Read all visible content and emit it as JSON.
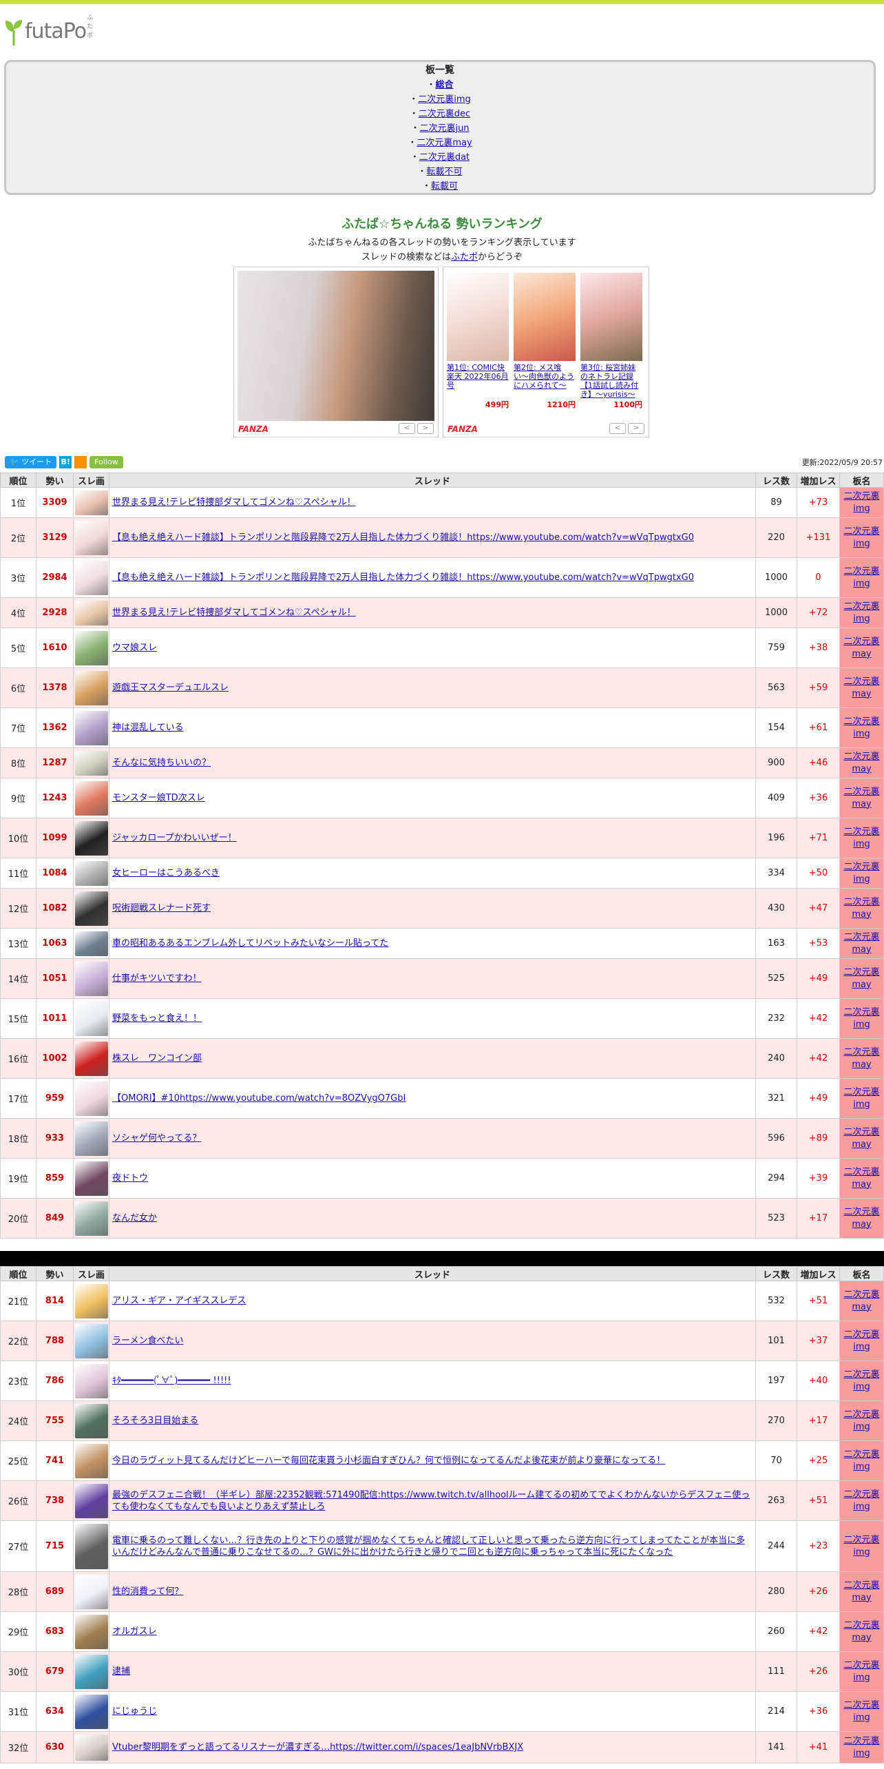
{
  "header": {
    "logo_text": "futaPo",
    "logo_ruby": "ふたポ"
  },
  "boards": {
    "title": "板一覧",
    "items": [
      {
        "label": "総合",
        "selected": true
      },
      {
        "label": "二次元裏img"
      },
      {
        "label": "二次元裏dec"
      },
      {
        "label": "二次元裏jun"
      },
      {
        "label": "二次元裏may"
      },
      {
        "label": "二次元裏dat"
      },
      {
        "label": "転載不可"
      },
      {
        "label": "転載可"
      }
    ]
  },
  "ranking": {
    "title": "ふたば☆ちゃんねる 勢いランキング",
    "desc1": "ふたばちゃんねるの各スレッドの勢いをランキング表示しています",
    "desc2_pre": "スレッドの検索などは",
    "desc2_link": "ふたポ",
    "desc2_post": "からどうぞ"
  },
  "ads": {
    "brand": "FANZA",
    "items": [
      {
        "title": "第1位: COMIC快楽天 2022年06月号",
        "price": "499円"
      },
      {
        "title": "第2位: メス喰い〜肉色獣のようにハメられて〜",
        "price": "1210円"
      },
      {
        "title": "第3位: 桜宮姉妹のネトラレ記録【1話試し読み付き】〜yurisis〜",
        "price": "1100円"
      }
    ]
  },
  "social": {
    "tweet": "ツイート",
    "hatena": "B!",
    "follow": "Follow"
  },
  "updated": "更新:2022/05/9 20:57",
  "columns": [
    "順位",
    "勢い",
    "スレ画",
    "スレッド",
    "レス数",
    "増加レス",
    "板名"
  ],
  "rows": [
    {
      "rank": "1位",
      "ikioi": "3309",
      "title": "世界まる見え!テレビ特捜部ダマしてゴメンね♡スペシャル！",
      "res": "89",
      "inc": "+73",
      "board": "二次元裏img"
    },
    {
      "rank": "2位",
      "ikioi": "3129",
      "title": "【息も絶え絶えハード雑談】トランポリンと階段昇降で2万人目指した体力づくり雑談！https://www.youtube.com/watch?v=wVqTpwgtxG0",
      "res": "220",
      "inc": "+131",
      "board": "二次元裏img"
    },
    {
      "rank": "3位",
      "ikioi": "2984",
      "title": "【息も絶え絶えハード雑談】トランポリンと階段昇降で2万人目指した体力づくり雑談！https://www.youtube.com/watch?v=wVqTpwgtxG0",
      "res": "1000",
      "inc": "0",
      "board": "二次元裏img"
    },
    {
      "rank": "4位",
      "ikioi": "2928",
      "title": "世界まる見え!テレビ特捜部ダマしてゴメンね♡スペシャル！",
      "res": "1000",
      "inc": "+72",
      "board": "二次元裏img"
    },
    {
      "rank": "5位",
      "ikioi": "1610",
      "title": "ウマ娘スレ",
      "res": "759",
      "inc": "+38",
      "board": "二次元裏may"
    },
    {
      "rank": "6位",
      "ikioi": "1378",
      "title": "遊戯王マスターデュエルスレ",
      "res": "563",
      "inc": "+59",
      "board": "二次元裏may"
    },
    {
      "rank": "7位",
      "ikioi": "1362",
      "title": "神は混乱している",
      "res": "154",
      "inc": "+61",
      "board": "二次元裏img"
    },
    {
      "rank": "8位",
      "ikioi": "1287",
      "title": "そんなに気持ちいいの？",
      "res": "900",
      "inc": "+46",
      "board": "二次元裏may"
    },
    {
      "rank": "9位",
      "ikioi": "1243",
      "title": "モンスター娘TD次スレ",
      "res": "409",
      "inc": "+36",
      "board": "二次元裏may"
    },
    {
      "rank": "10位",
      "ikioi": "1099",
      "title": "ジャッカロープかわいいぜー！",
      "res": "196",
      "inc": "+71",
      "board": "二次元裏img"
    },
    {
      "rank": "11位",
      "ikioi": "1084",
      "title": "女ヒーローはこうあるべき",
      "res": "334",
      "inc": "+50",
      "board": "二次元裏img"
    },
    {
      "rank": "12位",
      "ikioi": "1082",
      "title": "呪術廻戦スレナード死す",
      "res": "430",
      "inc": "+47",
      "board": "二次元裏may"
    },
    {
      "rank": "13位",
      "ikioi": "1063",
      "title": "車の昭和あるあるエンブレム外してリベットみたいなシール貼ってた",
      "res": "163",
      "inc": "+53",
      "board": "二次元裏may"
    },
    {
      "rank": "14位",
      "ikioi": "1051",
      "title": "仕事がキツいですわ！",
      "res": "525",
      "inc": "+49",
      "board": "二次元裏may"
    },
    {
      "rank": "15位",
      "ikioi": "1011",
      "title": "野菜をもっと食え！！",
      "res": "232",
      "inc": "+42",
      "board": "二次元裏img"
    },
    {
      "rank": "16位",
      "ikioi": "1002",
      "title": "株スレ　ワンコイン部",
      "res": "240",
      "inc": "+42",
      "board": "二次元裏may"
    },
    {
      "rank": "17位",
      "ikioi": "959",
      "title": "【OMORI】#10https://www.youtube.com/watch?v=8OZVygO7GbI",
      "res": "321",
      "inc": "+49",
      "board": "二次元裏img"
    },
    {
      "rank": "18位",
      "ikioi": "933",
      "title": "ソシャゲ何やってる？",
      "res": "596",
      "inc": "+89",
      "board": "二次元裏may"
    },
    {
      "rank": "19位",
      "ikioi": "859",
      "title": "夜ドトウ",
      "res": "294",
      "inc": "+39",
      "board": "二次元裏may"
    },
    {
      "rank": "20位",
      "ikioi": "849",
      "title": "なんだ女か",
      "res": "523",
      "inc": "+17",
      "board": "二次元裏may"
    },
    {
      "rank": "21位",
      "ikioi": "814",
      "title": "アリス・ギア・アイギススレデス",
      "res": "532",
      "inc": "+51",
      "board": "二次元裏may"
    },
    {
      "rank": "22位",
      "ikioi": "788",
      "title": "ラーメン食べたい",
      "res": "101",
      "inc": "+37",
      "board": "二次元裏img"
    },
    {
      "rank": "23位",
      "ikioi": "786",
      "title": "ｷﾀ━━━━━━(ﾟ∀ﾟ)━━━━━━ !!!!!",
      "res": "197",
      "inc": "+40",
      "board": "二次元裏img"
    },
    {
      "rank": "24位",
      "ikioi": "755",
      "title": "そろそろ3日目始まる",
      "res": "270",
      "inc": "+17",
      "board": "二次元裏img"
    },
    {
      "rank": "25位",
      "ikioi": "741",
      "title": "今日のラヴィット見てるんだけどヒーハーで毎回花束貰う小杉面白すぎひん？何で恒例になってるんだよ後花束が前より豪華になってる！",
      "res": "70",
      "inc": "+25",
      "board": "二次元裏img"
    },
    {
      "rank": "26位",
      "ikioi": "738",
      "title": "最強のデスフェニ合戦！（半ギレ）部屋:22352観戦:571490配信:https://www.twitch.tv/allhoolルーム建てるの初めてでよくわかんないからデスフェニ使っても使わなくてもなんでも良いよとりあえず禁止しろ",
      "res": "263",
      "inc": "+51",
      "board": "二次元裏img"
    },
    {
      "rank": "27位",
      "ikioi": "715",
      "title": "電車に乗るのって難しくない…？行き先の上りと下りの感覚が掴めなくてちゃんと確認して正しいと思って乗ったら逆方向に行ってしまってたことが本当に多いんだけどみんなんで普通に乗りこなせてるの…？GWに外に出かけたら行きと帰りで二回とも逆方向に乗っちゃって本当に死にたくなった",
      "res": "244",
      "inc": "+23",
      "board": "二次元裏img"
    },
    {
      "rank": "28位",
      "ikioi": "689",
      "title": "性的消費って何？",
      "res": "280",
      "inc": "+26",
      "board": "二次元裏may"
    },
    {
      "rank": "29位",
      "ikioi": "683",
      "title": "オルガスレ",
      "res": "260",
      "inc": "+42",
      "board": "二次元裏may"
    },
    {
      "rank": "30位",
      "ikioi": "679",
      "title": "逮捕",
      "res": "111",
      "inc": "+26",
      "board": "二次元裏img"
    },
    {
      "rank": "31位",
      "ikioi": "634",
      "title": "にじゅうじ",
      "res": "214",
      "inc": "+36",
      "board": "二次元裏img"
    },
    {
      "rank": "32位",
      "ikioi": "630",
      "title": "Vtuber黎明期をずっと語ってるリスナーが濃すぎる…https://twitter.com/i/spaces/1eaJbNVrbBXJX",
      "res": "141",
      "inc": "+41",
      "board": "二次元裏img"
    }
  ],
  "colors": {
    "accent_bar": "#c8e13c",
    "title_green": "#3d8b3d",
    "ikioi_red": "#c00000",
    "row_even": "#fde9ea",
    "board_cell": "#f79d9d"
  }
}
